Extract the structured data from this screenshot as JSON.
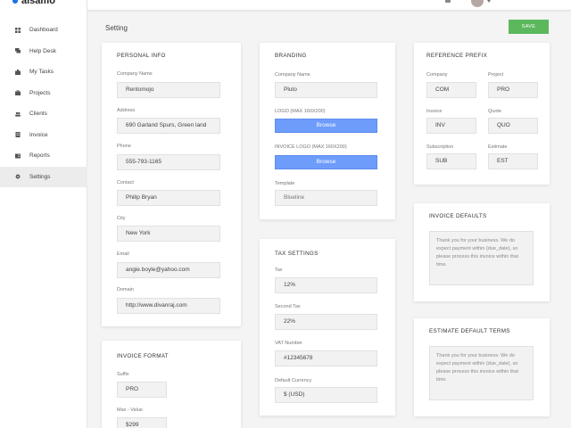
{
  "app": {
    "brand": "alsamo"
  },
  "sidebar": {
    "items": [
      {
        "label": "Dashboard",
        "icon": "dashboard-icon"
      },
      {
        "label": "Help Desk",
        "icon": "chat-icon"
      },
      {
        "label": "My Tasks",
        "icon": "puzzle-icon"
      },
      {
        "label": "Projects",
        "icon": "briefcase-icon"
      },
      {
        "label": "Clients",
        "icon": "users-icon"
      },
      {
        "label": "Invoice",
        "icon": "invoice-icon"
      },
      {
        "label": "Reports",
        "icon": "reports-icon"
      },
      {
        "label": "Settings",
        "icon": "gear-icon",
        "active": true
      }
    ]
  },
  "page": {
    "title": "Setting",
    "save_label": "SAVE"
  },
  "personal_info": {
    "title": "PERSONAL INFO",
    "fields": [
      {
        "label": "Company Name",
        "value": "Rentomojo"
      },
      {
        "label": "Address",
        "value": "690 Garland Spurs, Green land"
      },
      {
        "label": "Phone",
        "value": "555-793-1165"
      },
      {
        "label": "Contact",
        "value": "Philip Bryan"
      },
      {
        "label": "City",
        "value": "New York"
      },
      {
        "label": "Email",
        "value": "angie.boyle@yahoo.com"
      },
      {
        "label": "Domain",
        "value": "http://www.divanraj.com"
      }
    ]
  },
  "invoice_format": {
    "title": "INVOICE FORMAT",
    "fields": [
      {
        "label": "Suffix",
        "value": "PRO"
      },
      {
        "label": "Max - Value",
        "value": "$299"
      }
    ]
  },
  "branding": {
    "title": "BRANDING",
    "company_label": "Company Name",
    "company_value": "Pluto",
    "logo_label": "LOGO (MAX 160X200)",
    "logo_button": "Browse",
    "invoice_logo_label": "INVOICE LOGO (MAX 160X200)",
    "invoice_logo_button": "Browse",
    "template_label": "Template",
    "template_value": "Blueline"
  },
  "tax_settings": {
    "title": "TAX SETTINGS",
    "fields": [
      {
        "label": "Tax",
        "value": "12%"
      },
      {
        "label": "Second Tax",
        "value": "22%"
      },
      {
        "label": "VAT Number",
        "value": "#12345678"
      },
      {
        "label": "Default Currency",
        "value": "$ (USD)"
      }
    ]
  },
  "reference_prefix": {
    "title": "REFERENCE PREFIX",
    "fields": [
      {
        "label": "Company",
        "value": "COM"
      },
      {
        "label": "Project",
        "value": "PRO"
      },
      {
        "label": "Invoice",
        "value": "INV"
      },
      {
        "label": "Quote",
        "value": "QUO"
      },
      {
        "label": "Subscription",
        "value": "SUB"
      },
      {
        "label": "Estimate",
        "value": "EST"
      }
    ]
  },
  "invoice_defaults": {
    "title": "INVOICE DEFAULTS",
    "text": "Thank you for your business. We do expect payment within {due_date}, so please process this invoice within that time."
  },
  "estimate_defaults": {
    "title": "ESTIMATE DEFAULT TERMS",
    "text": "Thank you for your business. We do expect payment within {due_date}, so please process this invoice within that time."
  },
  "colors": {
    "accent": "#6e9cfb",
    "save": "#5cb85c",
    "brand": "#1a73e8"
  }
}
